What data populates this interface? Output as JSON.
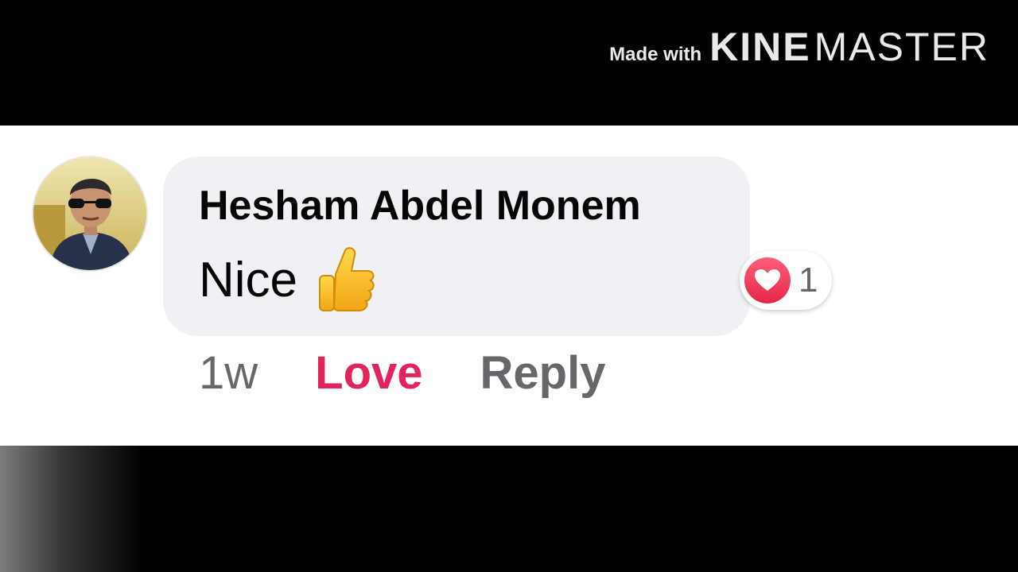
{
  "watermark": {
    "made_with": "Made with",
    "brand_bold": "KINE",
    "brand_light": "MASTER"
  },
  "comment": {
    "author": "Hesham Abdel Monem",
    "text": "Nice",
    "emoji_icon": "thumbs-up-icon",
    "avatar_icon": "profile-photo-avatar",
    "reaction": {
      "icon": "heart-icon",
      "count": "1",
      "color": "#e0245e"
    },
    "actions": {
      "time": "1w",
      "love_label": "Love",
      "reply_label": "Reply"
    }
  },
  "colors": {
    "bubble_bg": "#eff1f4",
    "love_accent": "#e0245e",
    "secondary_text": "#65676b"
  }
}
